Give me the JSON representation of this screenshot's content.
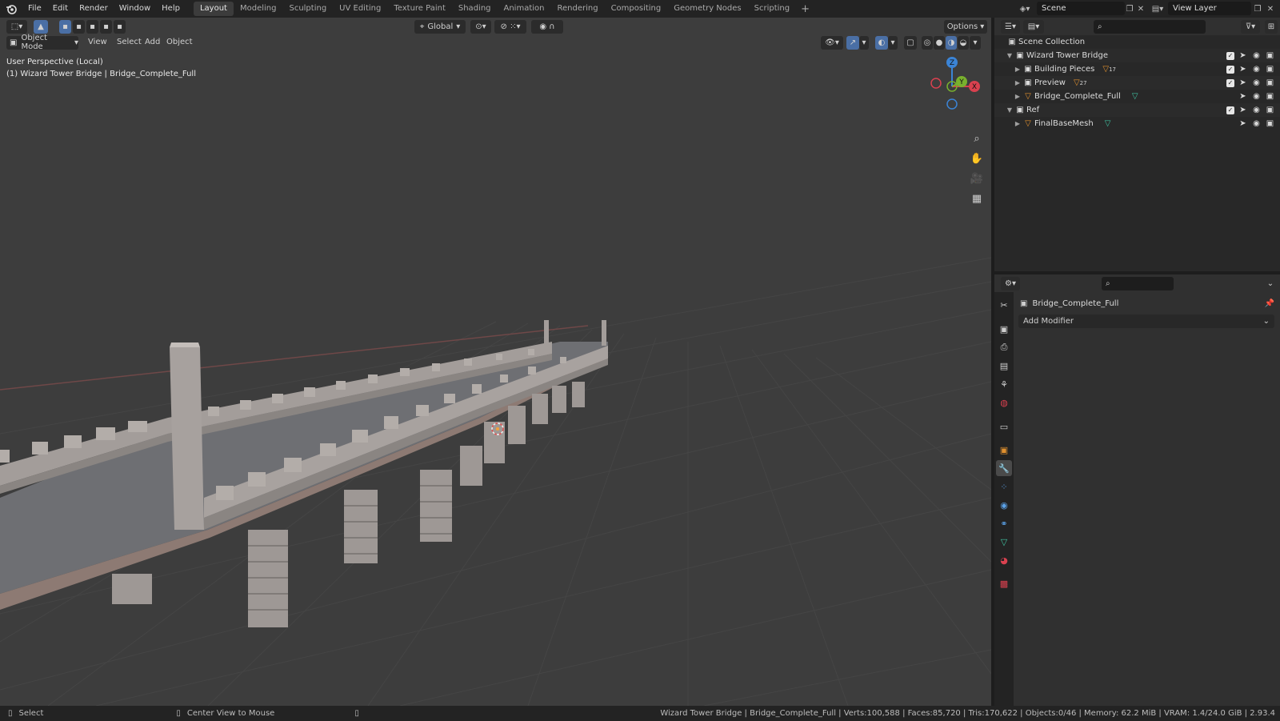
{
  "topbar": {
    "menus": [
      "File",
      "Edit",
      "Render",
      "Window",
      "Help"
    ],
    "workspaces": [
      "Layout",
      "Modeling",
      "Sculpting",
      "UV Editing",
      "Texture Paint",
      "Shading",
      "Animation",
      "Rendering",
      "Compositing",
      "Geometry Nodes",
      "Scripting"
    ],
    "active_workspace": "Layout",
    "scene_name": "Scene",
    "view_layer_name": "View Layer"
  },
  "viewport": {
    "mode": "Object Mode",
    "menus": [
      "View",
      "Select",
      "Add",
      "Object"
    ],
    "transform_orientation": "Global",
    "options_label": "Options",
    "perspective_label": "User Perspective (Local)",
    "active_object_label": "(1) Wizard Tower Bridge | Bridge_Complete_Full",
    "gizmo_axes": {
      "x": "X",
      "y": "Y",
      "z": "Z"
    },
    "colors": {
      "background": "#3d3d3d",
      "x_axis": "#d9414f",
      "y_axis": "#79b12e",
      "z_axis": "#3b84d6",
      "mesh": "#a39d9a"
    }
  },
  "outliner": {
    "root": "Scene Collection",
    "rows": [
      {
        "name": "Wizard Tower Bridge",
        "kind": "collection",
        "depth": 1,
        "expanded": true,
        "checked": true
      },
      {
        "name": "Building Pieces",
        "kind": "collection",
        "depth": 2,
        "expanded": false,
        "checked": true,
        "badge": "17"
      },
      {
        "name": "Preview",
        "kind": "collection",
        "depth": 2,
        "expanded": false,
        "checked": true,
        "badge": "27"
      },
      {
        "name": "Bridge_Complete_Full",
        "kind": "object",
        "depth": 2,
        "expanded": false,
        "checked": false
      },
      {
        "name": "Ref",
        "kind": "collection",
        "depth": 1,
        "expanded": true,
        "checked": true
      },
      {
        "name": "FinalBaseMesh",
        "kind": "object",
        "depth": 2,
        "expanded": false,
        "checked": false
      }
    ]
  },
  "properties": {
    "object_name": "Bridge_Complete_Full",
    "add_modifier_label": "Add Modifier",
    "active_tab": "modifier"
  },
  "statusbar": {
    "left_action": "Select",
    "middle_action": "Center View to Mouse",
    "stats": "Wizard Tower Bridge | Bridge_Complete_Full | Verts:100,588 | Faces:85,720 | Tris:170,622 | Objects:0/46 | Memory: 62.2 MiB | VRAM: 1.4/24.0 GiB | 2.93.4"
  }
}
